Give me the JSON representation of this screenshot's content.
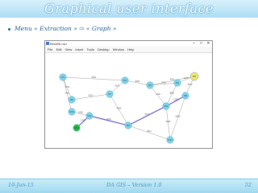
{
  "slide": {
    "title": "Graphical user interface",
    "bullet_text": "Menu « Extraction » ⇨ « Graph »",
    "footer_date": "10-Jun-15",
    "footer_center": "DA GIS – Version 1.0",
    "page_number": "52"
  },
  "window": {
    "title": "Bénéfik.mzi",
    "controls": [
      "–",
      "□",
      "✕"
    ],
    "menu": [
      "File",
      "Edit",
      "View",
      "Insert",
      "Tools",
      "Desktop",
      "Window",
      "Help"
    ]
  },
  "graph": {
    "colors": {
      "node": "#7fd6ec",
      "node_stroke": "#4a9fbf",
      "start": "#1fbf3a",
      "end": "#f4e76b",
      "edge": "#9a9a9a",
      "path": "#5e4fc6"
    },
    "nodes": [
      {
        "id": "n1",
        "label": "M1",
        "kind": "normal"
      },
      {
        "id": "n2",
        "label": "M2",
        "kind": "normal"
      },
      {
        "id": "n3",
        "label": "M3",
        "kind": "normal"
      },
      {
        "id": "n4",
        "label": "M4",
        "kind": "normal"
      },
      {
        "id": "n5",
        "label": "M5",
        "kind": "end"
      },
      {
        "id": "n6",
        "label": "M6",
        "kind": "normal"
      },
      {
        "id": "n7",
        "label": "M7",
        "kind": "normal"
      },
      {
        "id": "n8",
        "label": "M8",
        "kind": "normal"
      },
      {
        "id": "n9",
        "label": "M9",
        "kind": "normal"
      },
      {
        "id": "n10",
        "label": "M10",
        "kind": "normal"
      },
      {
        "id": "n11",
        "label": "M11",
        "kind": "normal"
      },
      {
        "id": "n12",
        "label": "M12",
        "kind": "normal"
      },
      {
        "id": "n13",
        "label": "M13",
        "kind": "start"
      },
      {
        "id": "n14",
        "label": "M14",
        "kind": "normal"
      }
    ],
    "edges": [
      {
        "from": "n1",
        "to": "n2",
        "label": "6841",
        "path": false
      },
      {
        "from": "n1",
        "to": "n10",
        "label": "5001",
        "path": false
      },
      {
        "from": "n1",
        "to": "n6",
        "label": "3162",
        "path": false
      },
      {
        "from": "n2",
        "to": "n3",
        "label": "8063",
        "path": false
      },
      {
        "from": "n2",
        "to": "n7",
        "label": "6163",
        "path": false
      },
      {
        "from": "n3",
        "to": "n5",
        "label": "4000",
        "path": false
      },
      {
        "from": "n3",
        "to": "n4",
        "label": "7000",
        "path": false
      },
      {
        "from": "n4",
        "to": "n5",
        "label": "4100",
        "path": false
      },
      {
        "from": "n4",
        "to": "n11",
        "label": "3800",
        "path": false
      },
      {
        "from": "n5",
        "to": "n8",
        "label": "3700",
        "path": false
      },
      {
        "from": "n6",
        "to": "n7",
        "label": "5100",
        "path": false
      },
      {
        "from": "n10",
        "to": "n12",
        "label": "2900",
        "path": false
      },
      {
        "from": "n12",
        "to": "n13",
        "label": "1200",
        "path": true
      },
      {
        "from": "n12",
        "to": "n9",
        "label": "2231",
        "path": true
      },
      {
        "from": "n9",
        "to": "n11",
        "label": "6071",
        "path": true
      },
      {
        "from": "n11",
        "to": "n8",
        "label": "1200",
        "path": true
      },
      {
        "from": "n7",
        "to": "n9",
        "label": "4600",
        "path": false
      },
      {
        "from": "n9",
        "to": "n14",
        "label": "5911",
        "path": false
      },
      {
        "from": "n11",
        "to": "n14",
        "label": "4300",
        "path": false
      },
      {
        "from": "n8",
        "to": "n14",
        "label": "5500",
        "path": false
      },
      {
        "from": "n3",
        "to": "n11",
        "label": "4100",
        "path": false
      }
    ]
  }
}
